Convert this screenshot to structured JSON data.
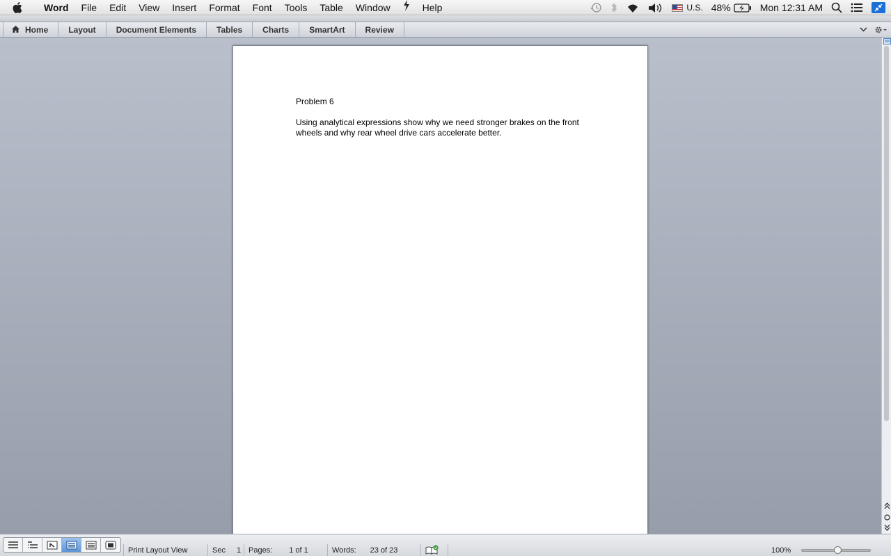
{
  "menubar": {
    "app_name": "Word",
    "items": [
      "File",
      "Edit",
      "View",
      "Insert",
      "Format",
      "Font",
      "Tools",
      "Table",
      "Window"
    ],
    "help": "Help",
    "status": {
      "input_source": "U.S.",
      "battery": "48%",
      "clock": "Mon 12:31 AM"
    }
  },
  "ribbon": {
    "tabs": [
      "Home",
      "Layout",
      "Document Elements",
      "Tables",
      "Charts",
      "SmartArt",
      "Review"
    ]
  },
  "document": {
    "paragraphs": [
      "Problem 6",
      "Using analytical expressions show why we need stronger brakes on the front wheels and why rear wheel drive cars accelerate better."
    ]
  },
  "statusbar": {
    "view_name": "Print Layout View",
    "section_label": "Sec",
    "section_value": "1",
    "pages_label": "Pages:",
    "pages_value": "1 of 1",
    "words_label": "Words:",
    "words_value": "23 of 23",
    "zoom": "100%"
  },
  "zoom_level_percent": 100,
  "colors": {
    "workspace_top": "#b9bfcb",
    "workspace_bottom": "#979daa",
    "active_view": "#5f96d8",
    "accent": "#1b6fd6"
  },
  "icons": [
    "apple-icon",
    "scripts-icon",
    "time-machine-icon",
    "bluetooth-icon",
    "wifi-icon",
    "volume-icon",
    "battery-icon",
    "spotlight-icon",
    "notification-center-icon",
    "home-icon",
    "chevron-down-icon",
    "gear-icon",
    "spell-check-icon"
  ]
}
